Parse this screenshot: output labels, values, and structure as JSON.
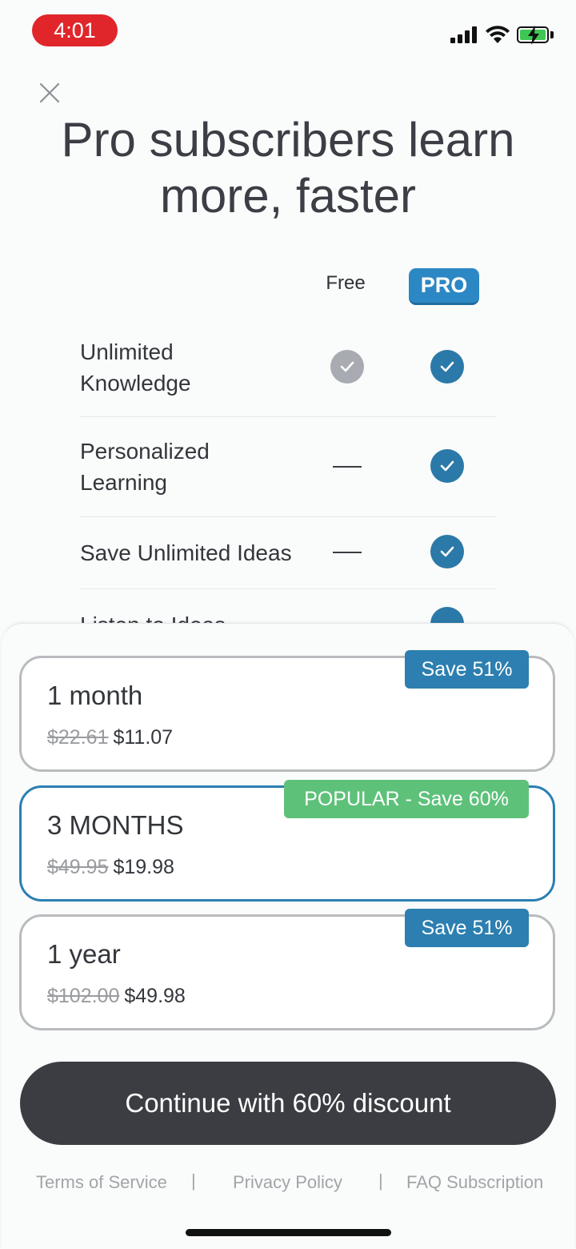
{
  "status_bar": {
    "time": "4:01"
  },
  "headline": {
    "line1": "Pro subscribers learn",
    "line2": "more, faster"
  },
  "comparison": {
    "free_label": "Free",
    "pro_label": "PRO",
    "features": [
      {
        "label_line1": "Unlimited",
        "label_line2": "Knowledge",
        "free": "check",
        "pro": "check"
      },
      {
        "label_line1": "Personalized",
        "label_line2": "Learning",
        "free": "none",
        "pro": "check"
      },
      {
        "label_line1": "Save Unlimited Ideas",
        "label_line2": "",
        "free": "none",
        "pro": "check"
      },
      {
        "label_line1": "Listen to Ideas",
        "label_line2": "",
        "free": "none",
        "pro": "check"
      }
    ]
  },
  "plans": [
    {
      "title": "1 month",
      "old_price": "$22.61",
      "price": "$11.07",
      "badge": "Save 51%",
      "selected": false
    },
    {
      "title": "3 MONTHS",
      "old_price": "$49.95",
      "price": "$19.98",
      "badge": "POPULAR - Save 60%",
      "selected": true
    },
    {
      "title": "1 year",
      "old_price": "$102.00",
      "price": "$49.98",
      "badge": "Save 51%",
      "selected": false
    }
  ],
  "cta_label": "Continue with 60% discount",
  "footer": {
    "terms": "Terms of Service",
    "privacy": "Privacy Policy",
    "faq": "FAQ Subscription",
    "separator": "|"
  },
  "colors": {
    "accent_blue": "#2c88c4",
    "popular_green": "#5ec17a",
    "cta_dark": "#3b3d42"
  }
}
